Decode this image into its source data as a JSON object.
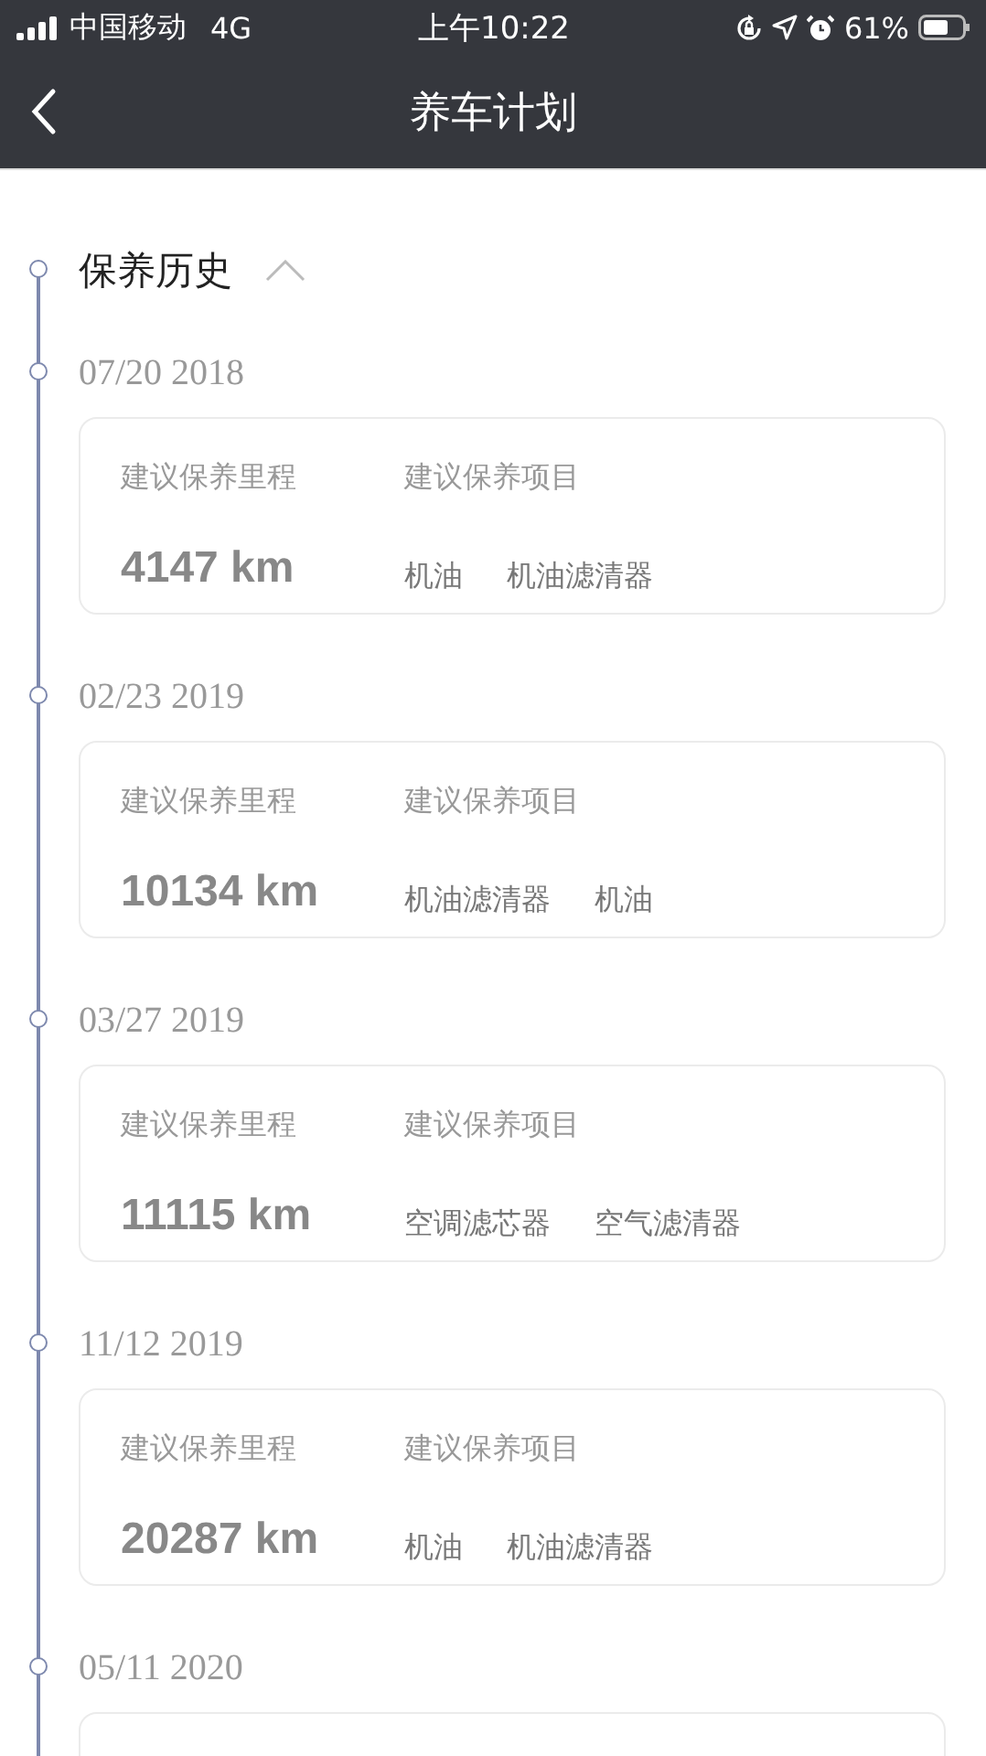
{
  "status_bar": {
    "carrier": "中国移动",
    "network": "4G",
    "time": "上午10:22",
    "battery": "61%"
  },
  "nav_bar": {
    "title": "养车计划"
  },
  "section": {
    "title": "保养历史",
    "expanded": true
  },
  "entries": [
    {
      "date": "07/20 2018",
      "mileage_label": "建议保养里程",
      "mileage": "4147 km",
      "items_label": "建议保养项目",
      "items": [
        "机油",
        "机油滤清器"
      ]
    },
    {
      "date": "02/23 2019",
      "mileage_label": "建议保养里程",
      "mileage": "10134 km",
      "items_label": "建议保养项目",
      "items": [
        "机油滤清器",
        "机油"
      ]
    },
    {
      "date": "03/27 2019",
      "mileage_label": "建议保养里程",
      "mileage": "11115 km",
      "items_label": "建议保养项目",
      "items": [
        "空调滤芯器",
        "空气滤清器"
      ]
    },
    {
      "date": "11/12 2019",
      "mileage_label": "建议保养里程",
      "mileage": "20287 km",
      "items_label": "建议保养项目",
      "items": [
        "机油",
        "机油滤清器"
      ]
    },
    {
      "date": "05/11 2020"
    }
  ]
}
